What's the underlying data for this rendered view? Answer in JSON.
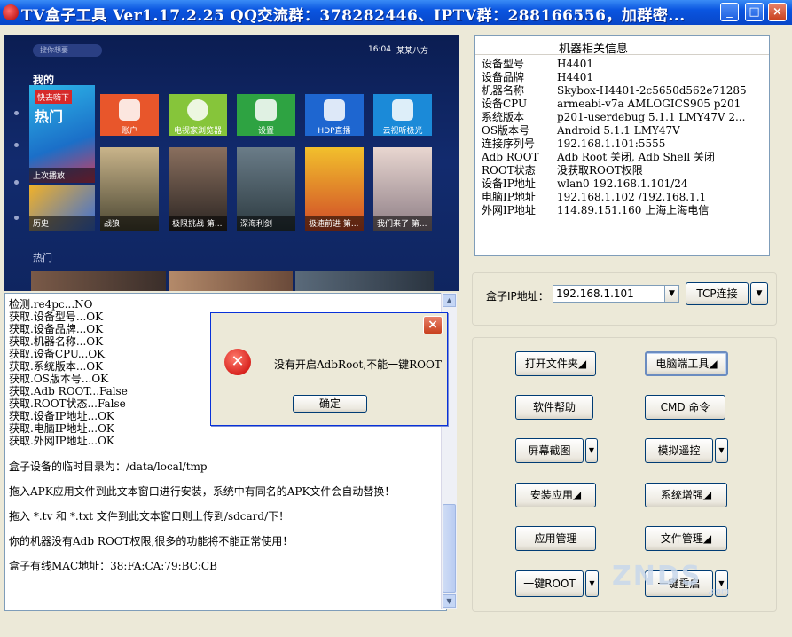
{
  "window": {
    "title": "TV盒子工具 Ver1.17.2.25 QQ交流群：378282446、IPTV群：288166556，加群密..."
  },
  "tv_screen": {
    "search_placeholder": "搜你想要",
    "clock": "16:04",
    "brand": "某某八方",
    "section_mine": "我的",
    "section_hot": "热门",
    "featured_top": "快去嗨下",
    "featured_big": "热门",
    "featured_bottom": "上次播放",
    "apps": [
      {
        "label": "账户",
        "color": "#e8562b"
      },
      {
        "label": "电视家浏览器",
        "color": "#86c53a"
      },
      {
        "label": "设置",
        "color": "#2ea342"
      },
      {
        "label": "HDP直播",
        "color": "#1e66d0"
      },
      {
        "label": "云视听极光",
        "color": "#1b8ad8"
      }
    ],
    "history_label": "历史",
    "posters": [
      "战狼",
      "极限挑战 第...",
      "深海利剑",
      "极速前进 第...",
      "我们来了 第..."
    ]
  },
  "device_info": {
    "header": "机器相关信息",
    "rows": [
      {
        "k": "设备型号",
        "v": "H4401"
      },
      {
        "k": "设备品牌",
        "v": "H4401"
      },
      {
        "k": "机器名称",
        "v": "Skybox-H4401-2c5650d562e71285"
      },
      {
        "k": "设备CPU",
        "v": "armeabi-v7a AMLOGICS905 p201"
      },
      {
        "k": "系统版本",
        "v": "p201-userdebug 5.1.1 LMY47V 2..."
      },
      {
        "k": "OS版本号",
        "v": "Android 5.1.1 LMY47V"
      },
      {
        "k": "连接序列号",
        "v": "192.168.1.101:5555"
      },
      {
        "k": "Adb ROOT",
        "v": "Adb Root 关闭, Adb Shell 关闭"
      },
      {
        "k": "ROOT状态",
        "v": "没获取ROOT权限"
      },
      {
        "k": "设备IP地址",
        "v": "wlan0 192.168.1.101/24"
      },
      {
        "k": "电脑IP地址",
        "v": "192.168.1.102 /192.168.1.1"
      },
      {
        "k": "外网IP地址",
        "v": "114.89.151.160 上海上海电信"
      }
    ]
  },
  "connection": {
    "ip_label": "盒子IP地址：",
    "ip_value": "192.168.1.101",
    "tcp_button": "TCP连接"
  },
  "buttons": {
    "open_folder": "打开文件夹◢",
    "pc_tools": "电脑端工具◢",
    "help": "软件帮助",
    "cmd": "CMD 命令",
    "screenshot": "屏幕截图",
    "remote": "模拟遥控",
    "install": "安装应用◢",
    "enhance": "系统增强◢",
    "app_manage": "应用管理",
    "file_manage": "文件管理◢",
    "one_root": "一键ROOT",
    "one_reboot": "一键重启"
  },
  "log": {
    "lines": [
      "检测.re4pc...NO",
      "获取.设备型号...OK",
      "获取.设备品牌...OK",
      "获取.机器名称...OK",
      "获取.设备CPU...OK",
      "获取.系统版本...OK",
      "获取.OS版本号...OK",
      "获取.Adb ROOT...False",
      "获取.ROOT状态...False",
      "获取.设备IP地址...OK",
      "获取.电脑IP地址...OK",
      "获取.外网IP地址...OK"
    ],
    "tmp_dir": "盒子设备的临时目录为：/data/local/tmp",
    "tip_apk": "拖入APK应用文件到此文本窗口进行安装，系统中有同名的APK文件会自动替换！",
    "tip_tv": "拖入 *.tv 和 *.txt 文件到此文本窗口则上传到/sdcard/下！",
    "warn_root": "你的机器没有Adb ROOT权限,很多的功能将不能正常使用！",
    "mac": "盒子有线MAC地址：38:FA:CA:79:BC:CB"
  },
  "dialog": {
    "message": "没有开启AdbRoot,不能一键ROOT",
    "ok": "确定",
    "close": "×"
  },
  "watermark": {
    "text": "ZNDS",
    "sub": ".com"
  }
}
